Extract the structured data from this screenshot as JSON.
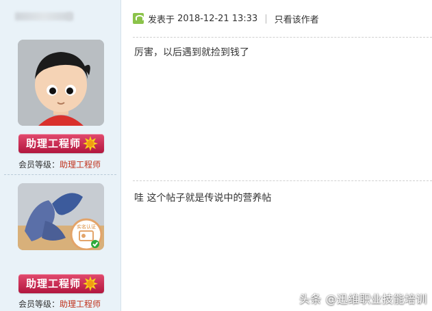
{
  "post1": {
    "meta_prefix": "发表于",
    "datetime": "2018-12-21 13:33",
    "separator": "|",
    "only_author_link": "只看该作者",
    "content": "厉害，以后遇到就捡到钱了"
  },
  "post2": {
    "content": "哇 这个帖子就是传说中的营养帖"
  },
  "user1": {
    "badge": "助理工程师",
    "level_label": "会员等级：",
    "level_value": "助理工程师"
  },
  "user2": {
    "badge": "助理工程师",
    "level_label": "会员等级：",
    "level_value": "助理工程师",
    "verified_label": "实名认证"
  },
  "watermark": "头条 @迅维职业技能培训",
  "colors": {
    "sidebar_bg": "#e9f2f8",
    "badge": "#c91f4b",
    "level_value": "#c0311b",
    "post_icon": "#8bc34a"
  },
  "icons": [
    "post-icon",
    "sun-badge-icon",
    "verified-check-icon"
  ]
}
